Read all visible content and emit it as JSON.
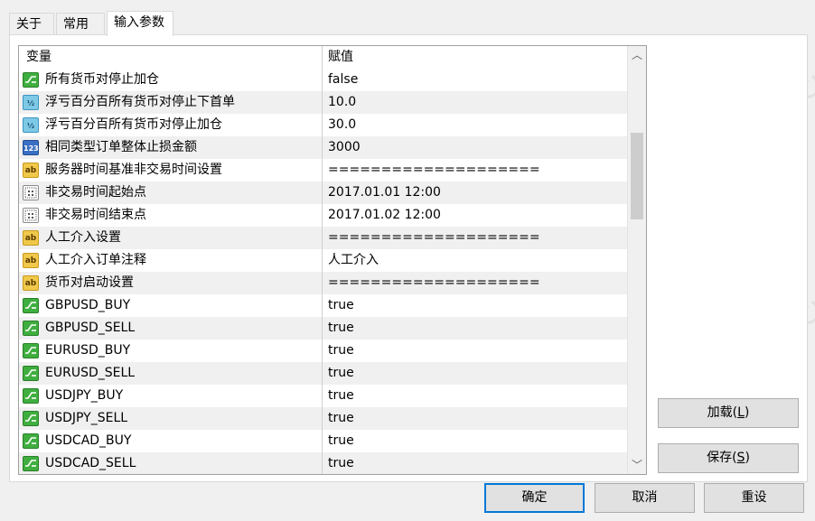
{
  "tabs": [
    {
      "label": "关于"
    },
    {
      "label": "常用"
    },
    {
      "label": "输入参数"
    }
  ],
  "table": {
    "col_variable": "变量",
    "col_value": "赋值",
    "rows": [
      {
        "icon": "bool",
        "name": "所有货币对停止加仓",
        "value": "false"
      },
      {
        "icon": "double",
        "name": "浮亏百分百所有货币对停止下首单",
        "value": "10.0"
      },
      {
        "icon": "double",
        "name": "浮亏百分百所有货币对停止加仓",
        "value": "30.0"
      },
      {
        "icon": "int",
        "name": "相同类型订单整体止损金额",
        "value": "3000"
      },
      {
        "icon": "string",
        "name": "服务器时间基准非交易时间设置",
        "value": "===================="
      },
      {
        "icon": "datetime",
        "name": "非交易时间起始点",
        "value": "2017.01.01 12:00"
      },
      {
        "icon": "datetime",
        "name": "非交易时间结束点",
        "value": "2017.01.02 12:00"
      },
      {
        "icon": "string",
        "name": "人工介入设置",
        "value": "===================="
      },
      {
        "icon": "string",
        "name": "人工介入订单注释",
        "value": "人工介入"
      },
      {
        "icon": "string",
        "name": "货币对启动设置",
        "value": "===================="
      },
      {
        "icon": "bool",
        "name": "GBPUSD_BUY",
        "value": "true"
      },
      {
        "icon": "bool",
        "name": "GBPUSD_SELL",
        "value": "true"
      },
      {
        "icon": "bool",
        "name": "EURUSD_BUY",
        "value": "true"
      },
      {
        "icon": "bool",
        "name": "EURUSD_SELL",
        "value": "true"
      },
      {
        "icon": "bool",
        "name": "USDJPY_BUY",
        "value": "true"
      },
      {
        "icon": "bool",
        "name": "USDJPY_SELL",
        "value": "true"
      },
      {
        "icon": "bool",
        "name": "USDCAD_BUY",
        "value": "true"
      },
      {
        "icon": "bool",
        "name": "USDCAD_SELL",
        "value": "true"
      }
    ]
  },
  "icon_labels": {
    "double": "½",
    "int": "123",
    "string": "ab"
  },
  "buttons": {
    "load": {
      "text": "加载(",
      "key": "L",
      "close": ")"
    },
    "save": {
      "text": "保存(",
      "key": "S",
      "close": ")"
    },
    "ok": "确定",
    "cancel": "取消",
    "reset": "重设"
  },
  "watermark": "EAHub.cn",
  "colors": {
    "accent": "#0078d7",
    "alt_row": "#f0f0f0"
  }
}
